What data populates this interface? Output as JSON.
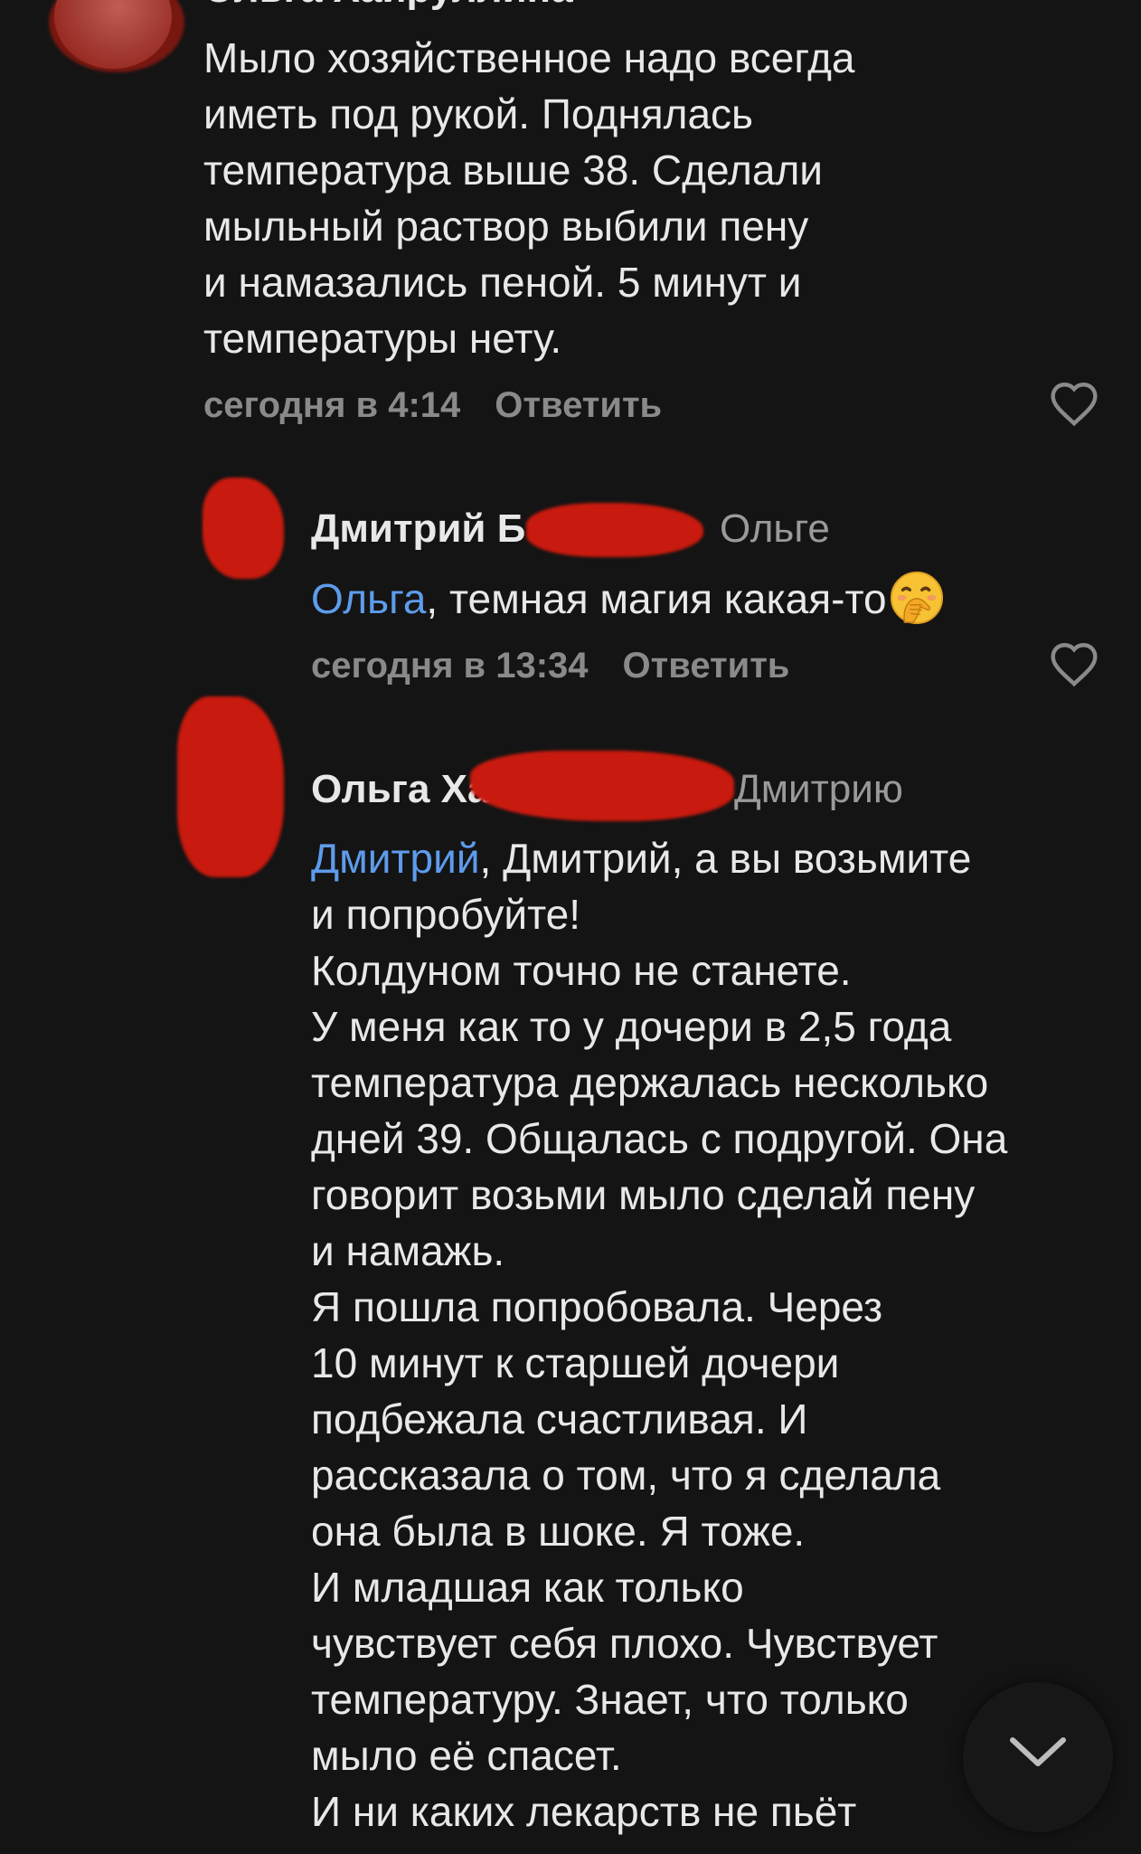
{
  "comments": [
    {
      "author": "Ольга Хайруллина",
      "text": "Мыло хозяйственное надо всегда\nиметь под рукой. Поднялась\nтемпература выше 38. Сделали\nмыльный раствор выбили пену\nи намазались пеной. 5 минут и\nтемпературы нету.",
      "time": "сегодня в 4:14",
      "reply_label": "Ответить"
    },
    {
      "author": "Дмитрий Б",
      "reply_to": "Ольге",
      "mention": "Ольга",
      "text": ", темная магия какая-то",
      "emoji": "face-with-hand-over-mouth",
      "time": "сегодня в 13:34",
      "reply_label": "Ответить"
    },
    {
      "author": "Ольга Ха",
      "reply_to": "Дмитрию",
      "mention": "Дмитрий",
      "first_line": ",  Дмитрий, а вы возьмите",
      "text": "и попробуйте!\nКолдуном точно не станете.\nУ меня как то у дочери в 2,5 года\nтемпература держалась несколько\nдней 39. Общалась с подругой. Она\nговорит возьми мыло сделай пену\nи намажь.\nЯ пошла попробовала. Через\n10 минут к старшей дочери\nподбежала счастливая. И\nрассказала о том, что я сделала\nона была в шоке. Я тоже.\n И младшая как только\nчувствует себя плохо. Чувствует\nтемпературу. Знает, что только\nмыло её спасет.\n И ни каких лекарств не пьёт"
    }
  ],
  "icons": {
    "like": "heart-outline-icon",
    "scroll": "chevron-down-icon"
  },
  "colors": {
    "background": "#141414",
    "text": "#e8e8e8",
    "mention": "#5d9cec",
    "meta": "#8a8a8a",
    "redaction": "#c81a0e"
  }
}
